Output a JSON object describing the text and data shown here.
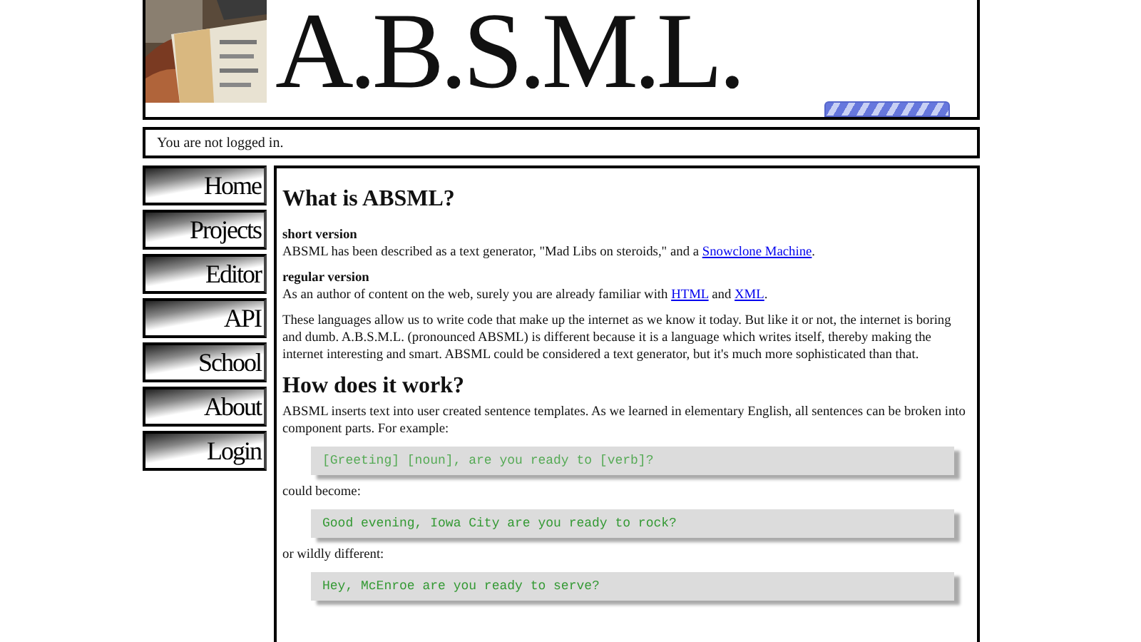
{
  "header": {
    "logo_text": "A.B.S.M.L."
  },
  "status": "You are not logged in.",
  "nav": [
    {
      "label": "Home"
    },
    {
      "label": "Projects"
    },
    {
      "label": "Editor"
    },
    {
      "label": "API"
    },
    {
      "label": "School"
    },
    {
      "label": "About"
    },
    {
      "label": "Login"
    }
  ],
  "content": [
    {
      "kind": "heading",
      "text": "What is ABSML?"
    },
    {
      "kind": "subheading",
      "text": "short version"
    },
    {
      "kind": "paragraph",
      "parts": [
        {
          "kind": "text",
          "text": "ABSML has been described as a text generator, \"Mad Libs on steroids,\" and a "
        },
        {
          "kind": "link",
          "text": "Snowclone Machine"
        },
        {
          "kind": "text",
          "text": "."
        }
      ]
    },
    {
      "kind": "subheading",
      "text": "regular version"
    },
    {
      "kind": "paragraph",
      "parts": [
        {
          "kind": "text",
          "text": "As an author of content on the web, surely you are already familiar with "
        },
        {
          "kind": "link",
          "text": "HTML"
        },
        {
          "kind": "text",
          "text": " and "
        },
        {
          "kind": "link",
          "text": "XML"
        },
        {
          "kind": "text",
          "text": "."
        }
      ]
    },
    {
      "kind": "paragraph",
      "parts": [
        {
          "kind": "text",
          "text": "These languages allow us to write code that make up the internet as we know it today. But like it or not, the internet is boring and dumb. A.B.S.M.L. (pronounced ABSML) is different because it is a language which writes itself, thereby making the internet interesting and smart. ABSML could be considered a text generator, but it's much more sophisticated than that."
        }
      ]
    },
    {
      "kind": "heading",
      "text": "How does it work?"
    },
    {
      "kind": "paragraph",
      "parts": [
        {
          "kind": "text",
          "text": "ABSML inserts text into user created sentence templates. As we learned in elementary English, all sentences can be broken into component parts. For example:"
        }
      ]
    },
    {
      "kind": "template",
      "text": "[Greeting] [noun], are you ready to [verb]?"
    },
    {
      "kind": "paragraph",
      "parts": [
        {
          "kind": "text",
          "text": "could become:"
        }
      ]
    },
    {
      "kind": "example",
      "text": "Good evening, Iowa City are you ready to rock?"
    },
    {
      "kind": "paragraph",
      "parts": [
        {
          "kind": "text",
          "text": "or wildly different:"
        }
      ]
    },
    {
      "kind": "example",
      "text": "Hey, McEnroe are you ready to serve?"
    }
  ]
}
